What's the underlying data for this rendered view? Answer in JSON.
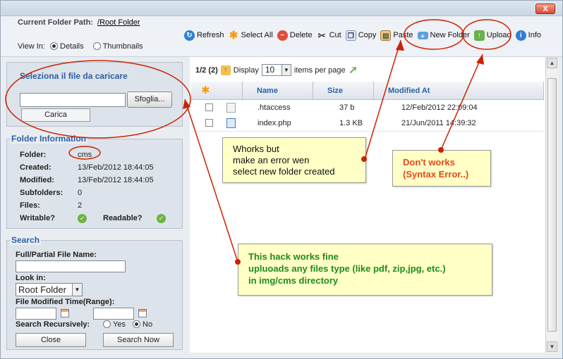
{
  "window": {
    "close_label": "X"
  },
  "header": {
    "path_label": "Current Folder Path:",
    "path_value": "/Root Folder",
    "view_in_label": "View In:",
    "view_details": "Details",
    "view_thumbnails": "Thumbnails"
  },
  "toolbar": {
    "refresh": "Refresh",
    "select_all": "Select All",
    "delete": "Delete",
    "cut": "Cut",
    "copy": "Copy",
    "paste": "Paste",
    "new_folder": "New Folder",
    "upload": "Upload",
    "info": "Info"
  },
  "upload": {
    "title": "Seleziona il file da caricare",
    "browse": "Sfoglia...",
    "load": "Carica"
  },
  "folder_info": {
    "title": "Folder Information",
    "folder_label": "Folder:",
    "folder_value": "cms",
    "created_label": "Created:",
    "created_value": "13/Feb/2012 18:44:05",
    "modified_label": "Modified:",
    "modified_value": "13/Feb/2012 18:44:05",
    "subfolders_label": "Subfolders:",
    "subfolders_value": "0",
    "files_label": "Files:",
    "files_value": "2",
    "writable_label": "Writable?",
    "readable_label": "Readable?"
  },
  "search": {
    "title": "Search",
    "name_label": "Full/Partial File Name:",
    "look_in_label": "Look in:",
    "look_in_value": "Root Folder",
    "time_label": "File Modified Time(Range):",
    "recursive_label": "Search Recursively:",
    "yes": "Yes",
    "no": "No",
    "close": "Close",
    "search_now": "Search Now"
  },
  "pager": {
    "page": "1/2 (2)",
    "display": "Display",
    "per_page_value": "10",
    "items_per_page": "items per page"
  },
  "grid": {
    "columns": [
      "Name",
      "Size",
      "Modified At"
    ],
    "rows": [
      {
        "name": ".htaccess",
        "size": "37 b",
        "modified": "12/Feb/2012 22:09:04"
      },
      {
        "name": "index.php",
        "size": "1.3 KB",
        "modified": "21/Jun/2011 14:39:32"
      }
    ]
  },
  "notes": {
    "a_line1": "Whorks but",
    "a_line2": "make an error wen",
    "a_line3": "select new folder created",
    "b_line1": "Don't works",
    "b_line2": "(Syntax Error..)",
    "c_line1": "This hack works fine",
    "c_line2": "upluoads any files type (like pdf, zip,jpg, etc.)",
    "c_line3": "in img/cms directory"
  },
  "colors": {
    "annotation_red": "#cc2200",
    "accent_blue": "#2b5fa6",
    "note_yellow": "#ffffc6"
  }
}
